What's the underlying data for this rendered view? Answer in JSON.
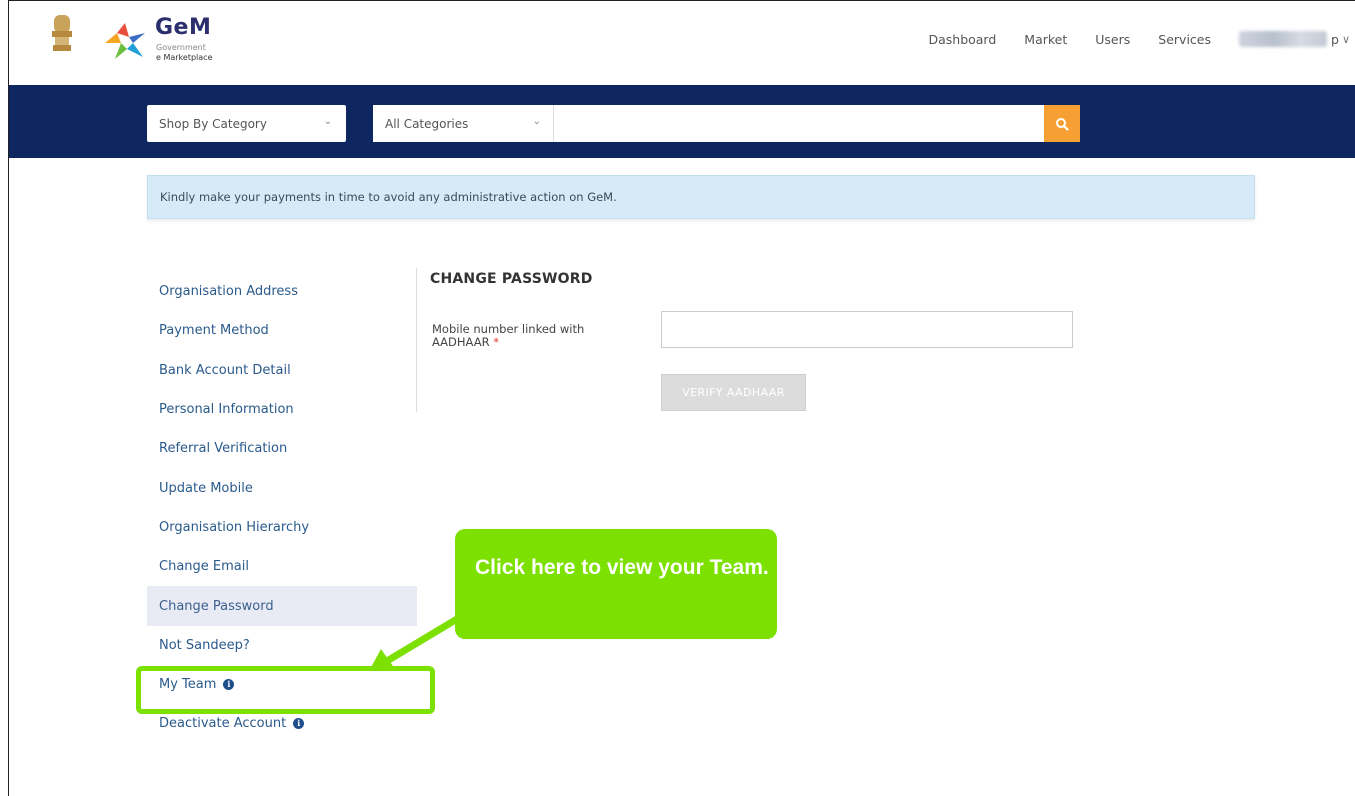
{
  "header": {
    "brand_name": "GeM",
    "brand_line1": "Government",
    "brand_line2": "e Marketplace",
    "nav": [
      "Dashboard",
      "Market",
      "Users",
      "Services"
    ],
    "user_suffix": "p"
  },
  "search": {
    "shop_by_category": "Shop By Category",
    "category_select": "All Categories",
    "placeholder": "",
    "button_icon": "search-icon",
    "button_color": "#f6a033",
    "bar_color": "#0f2760"
  },
  "alert": {
    "text": "Kindly make your payments in time to avoid any administrative action on GeM."
  },
  "sidebar": {
    "items": [
      {
        "label": "Organisation Address"
      },
      {
        "label": "Payment Method"
      },
      {
        "label": "Bank Account Detail"
      },
      {
        "label": "Personal Information"
      },
      {
        "label": "Referral Verification"
      },
      {
        "label": "Update Mobile"
      },
      {
        "label": "Organisation Hierarchy"
      },
      {
        "label": "Change Email"
      },
      {
        "label": "Change Password",
        "active": true
      },
      {
        "label": "Not Sandeep?"
      },
      {
        "label": "My Team",
        "info": true
      },
      {
        "label": "Deactivate Account",
        "info": true
      }
    ]
  },
  "main": {
    "title": "CHANGE PASSWORD",
    "mobile_label": "Mobile number linked with AADHAAR",
    "required_mark": "*",
    "mobile_value": "",
    "verify_button": "VERIFY AADHAAR"
  },
  "callout": {
    "text": "Click here to view your Team.",
    "color": "#7ce000"
  }
}
